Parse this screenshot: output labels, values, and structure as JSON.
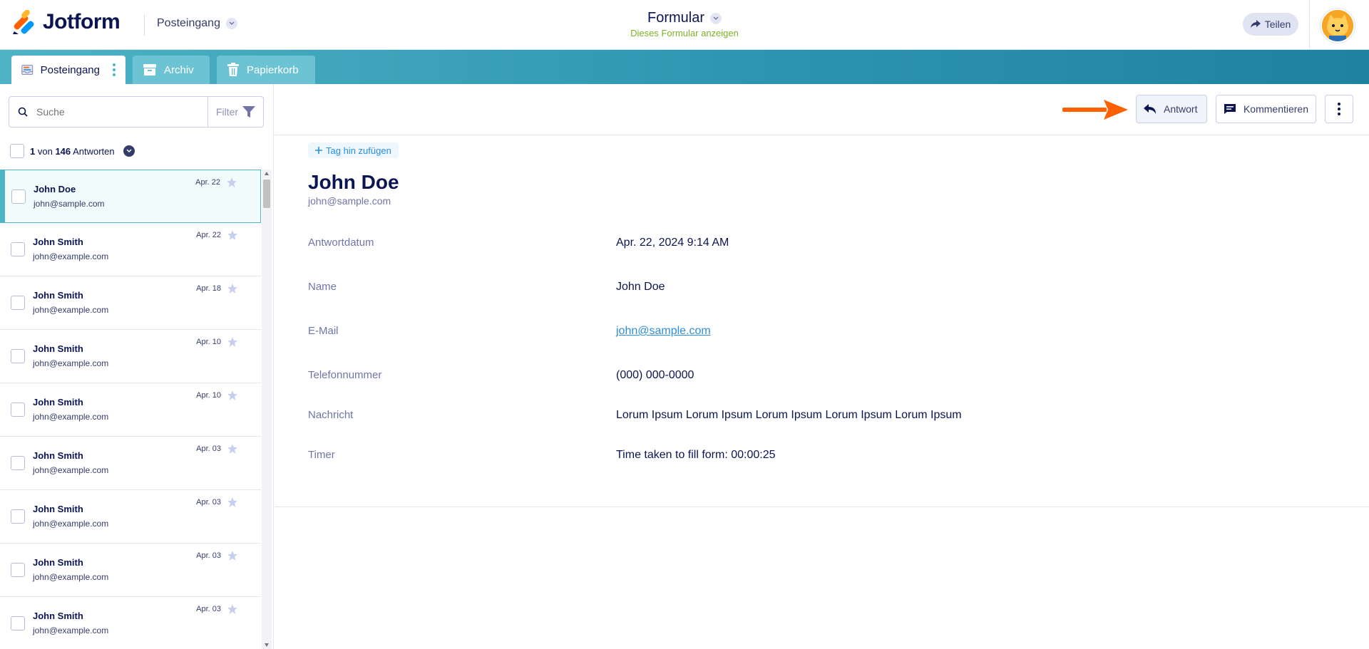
{
  "header": {
    "logo_text": "Jotform",
    "inbox_switch": "Posteingang",
    "form_title": "Formular",
    "form_subtitle": "Dieses Formular anzeigen",
    "share_label": "Teilen",
    "avatar_icon": "cat-avatar"
  },
  "tabs": [
    {
      "label": "Posteingang",
      "icon": "inbox-icon"
    },
    {
      "label": "Archiv",
      "icon": "archive-icon"
    },
    {
      "label": "Papierkorb",
      "icon": "trash-icon"
    }
  ],
  "sidebar": {
    "search_placeholder": "Suche",
    "filter_label": "Filter",
    "count": {
      "current": "1",
      "von": "von",
      "total": "146",
      "label": "Antworten"
    },
    "items": [
      {
        "name": "John Doe",
        "email": "john@sample.com",
        "date": "Apr. 22",
        "selected": true
      },
      {
        "name": "John Smith",
        "email": "john@example.com",
        "date": "Apr. 22"
      },
      {
        "name": "John Smith",
        "email": "john@example.com",
        "date": "Apr. 18"
      },
      {
        "name": "John Smith",
        "email": "john@example.com",
        "date": "Apr. 10"
      },
      {
        "name": "John Smith",
        "email": "john@example.com",
        "date": "Apr. 10"
      },
      {
        "name": "John Smith",
        "email": "john@example.com",
        "date": "Apr. 03"
      },
      {
        "name": "John Smith",
        "email": "john@example.com",
        "date": "Apr. 03"
      },
      {
        "name": "John Smith",
        "email": "john@example.com",
        "date": "Apr. 03"
      },
      {
        "name": "John Smith",
        "email": "john@example.com",
        "date": "Apr. 03"
      }
    ]
  },
  "toolbar": {
    "reply_label": "Antwort",
    "comment_label": "Kommentieren"
  },
  "submission": {
    "tag_label": "Tag hin zufügen",
    "name": "John Doe",
    "email": "john@sample.com",
    "fields": [
      {
        "label": "Antwortdatum",
        "value": "Apr. 22, 2024 9:14 AM"
      },
      {
        "label": "Name",
        "value": "John Doe"
      },
      {
        "label": "E-Mail",
        "value": "john@sample.com"
      },
      {
        "label": "Telefonnummer",
        "value": "(000) 000-0000"
      },
      {
        "label": "Nachricht",
        "value": "Lorum Ipsum Lorum Ipsum Lorum Ipsum Lorum Ipsum Lorum Ipsum"
      },
      {
        "label": "Timer",
        "value": "Time taken to fill form: 00:00:25"
      }
    ]
  },
  "colors": {
    "brand_navy": "#0a1551",
    "tabbar_teal": "#2d95b0",
    "accent_orange": "#ff6100",
    "link_blue": "#2b8fdd",
    "subtitle_green": "#7fb129"
  }
}
